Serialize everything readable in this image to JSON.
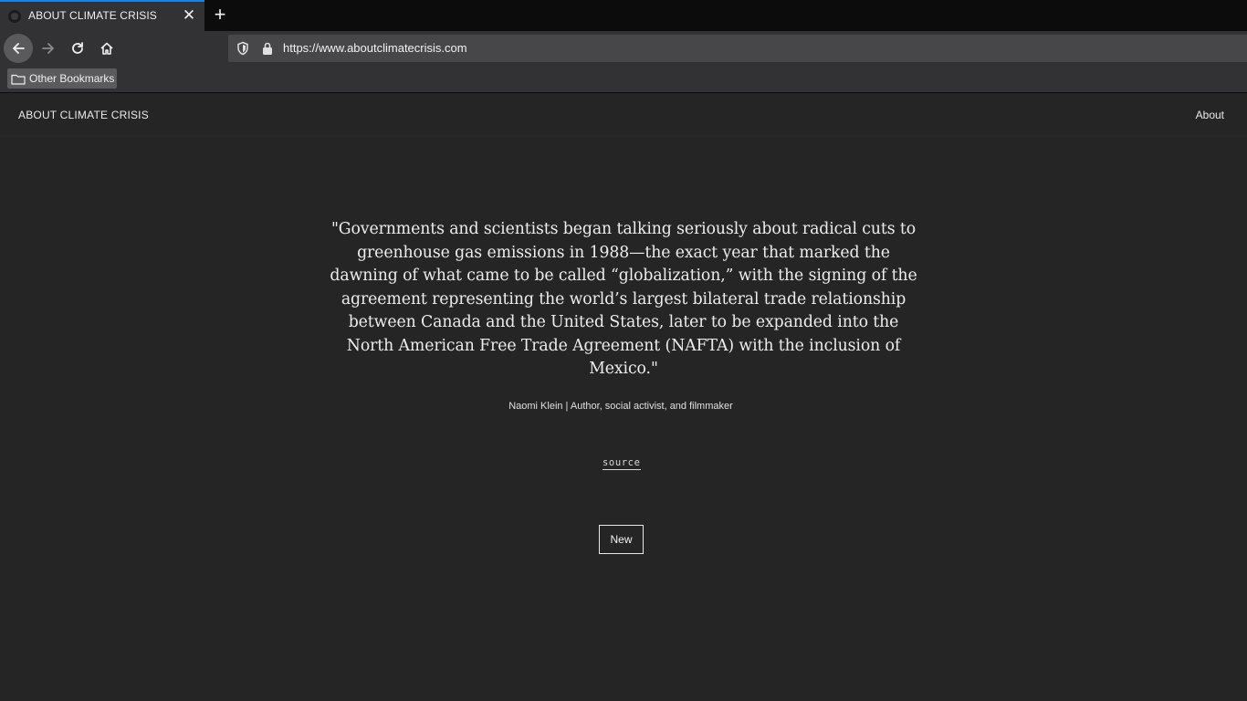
{
  "browser": {
    "tab": {
      "title": "ABOUT CLIMATE CRISIS",
      "close_glyph": "✕"
    },
    "new_tab_glyph": "+",
    "url": "https://www.aboutclimatecrisis.com",
    "bookmarks": [
      {
        "label": "Other Bookmarks",
        "icon": "folder-icon"
      }
    ],
    "icons": {
      "back": "back-arrow-icon",
      "forward": "forward-arrow-icon",
      "reload": "reload-icon",
      "home": "home-icon",
      "tracking": "shield-icon",
      "secure": "lock-icon"
    },
    "accent_color": "#0a84ff"
  },
  "site": {
    "logo": "ABOUT CLIMATE CRISIS",
    "nav": {
      "about": "About"
    },
    "quote": "\"Governments and scientists began talking seriously about radical cuts to greenhouse gas emissions in 1988—the exact year that marked the dawning of what came to be called “globalization,” with the signing of the agreement representing the world’s largest bilateral trade relationship between Canada and the United States, later to be expanded into the North American Free Trade Agreement (NAFTA) with the inclusion of Mexico.\"",
    "attribution": "Naomi Klein | Author, social activist, and filmmaker",
    "source_label": "source",
    "new_button": "New",
    "background_color": "#252525"
  }
}
